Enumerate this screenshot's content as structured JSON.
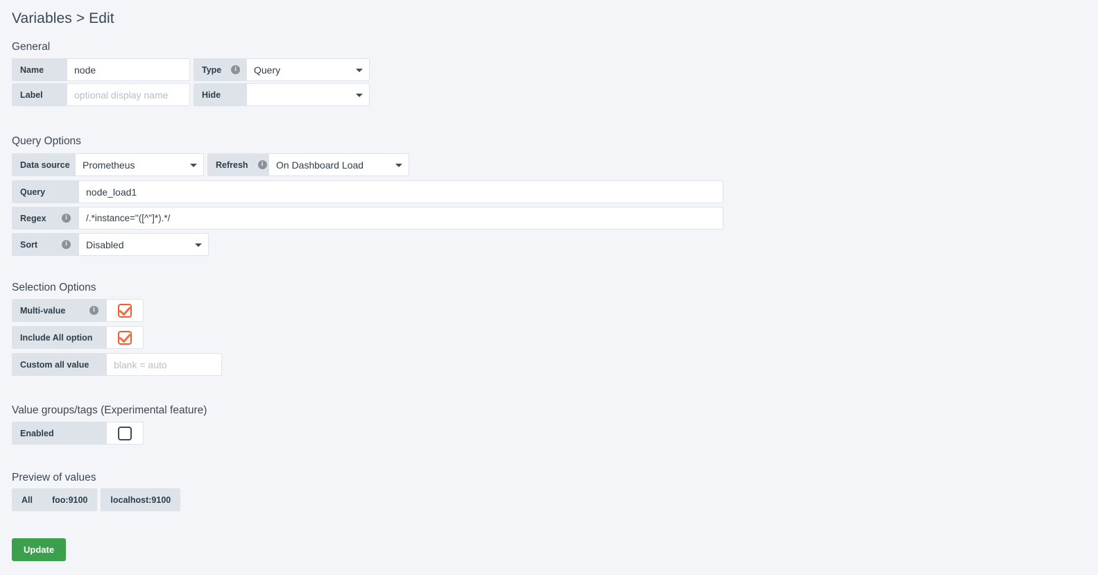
{
  "page_title": "Variables > Edit",
  "sections": {
    "general": {
      "title": "General",
      "name": {
        "label": "Name",
        "value": "node"
      },
      "type": {
        "label": "Type",
        "value": "Query",
        "info": "i"
      },
      "variable_label": {
        "label": "Label",
        "value": "",
        "placeholder": "optional display name"
      },
      "hide": {
        "label": "Hide",
        "value": ""
      }
    },
    "query_options": {
      "title": "Query Options",
      "data_source": {
        "label": "Data source",
        "value": "Prometheus"
      },
      "refresh": {
        "label": "Refresh",
        "value": "On Dashboard Load",
        "info": "i"
      },
      "query": {
        "label": "Query",
        "value": "node_load1"
      },
      "regex": {
        "label": "Regex",
        "value": "/.*instance=\"([^\"]*).*/",
        "info": "i"
      },
      "sort": {
        "label": "Sort",
        "value": "Disabled",
        "info": "i"
      }
    },
    "selection_options": {
      "title": "Selection Options",
      "multi_value": {
        "label": "Multi-value",
        "checked": true,
        "info": "i"
      },
      "include_all": {
        "label": "Include All option",
        "checked": true
      },
      "custom_all_value": {
        "label": "Custom all value",
        "value": "",
        "placeholder": "blank = auto"
      }
    },
    "value_groups": {
      "title": "Value groups/tags (Experimental feature)",
      "enabled": {
        "label": "Enabled",
        "checked": false
      }
    },
    "preview": {
      "title": "Preview of values",
      "values": [
        "All",
        "foo:9100",
        "localhost:9100"
      ]
    }
  },
  "actions": {
    "update_label": "Update"
  },
  "colors": {
    "accent_green": "#3ba04b",
    "checkbox_on": "#ef5b34",
    "label_bg": "#dde3e9",
    "page_bg": "#f4f5f8"
  }
}
